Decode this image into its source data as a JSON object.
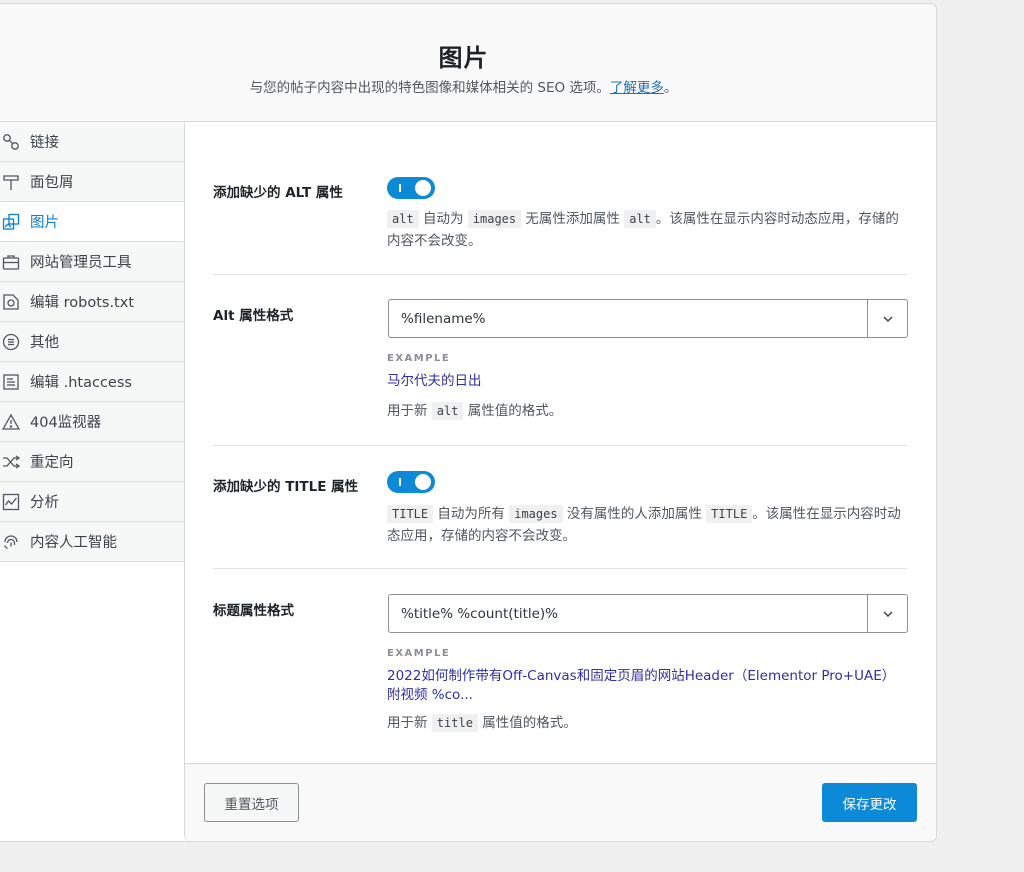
{
  "header": {
    "title": "图片",
    "description": "与您的帖子内容中出现的特色图像和媒体相关的 SEO 选项。",
    "learn_more": "了解更多",
    "description_end": "。"
  },
  "sidebar": {
    "items": [
      {
        "label": "链接",
        "icon": "link-icon"
      },
      {
        "label": "面包屑",
        "icon": "signpost-icon"
      },
      {
        "label": "图片",
        "icon": "images-icon",
        "active": true
      },
      {
        "label": "网站管理员工具",
        "icon": "briefcase-icon"
      },
      {
        "label": "编辑 robots.txt",
        "icon": "robot-file-icon"
      },
      {
        "label": "其他",
        "icon": "list-circle-icon"
      },
      {
        "label": "编辑 .htaccess",
        "icon": "document-icon"
      },
      {
        "label": "404监视器",
        "icon": "warning-icon"
      },
      {
        "label": "重定向",
        "icon": "shuffle-icon"
      },
      {
        "label": "分析",
        "icon": "chart-icon"
      },
      {
        "label": "内容人工智能",
        "icon": "fingerprint-icon"
      }
    ]
  },
  "settings": {
    "alt_toggle": {
      "label": "添加缺少的 ALT 属性",
      "enabled": true,
      "code1": "alt",
      "text1": " 自动为 ",
      "code2": "images",
      "text2": " 无属性添加属性 ",
      "code3": "alt",
      "text3": "。该属性在显示内容时动态应用，存储的内容不会改变。"
    },
    "alt_format": {
      "label": "Alt 属性格式",
      "value": "%filename%",
      "example_tag": "EXAMPLE",
      "example_value": "马尔代夫的日出",
      "help_pre": "用于新 ",
      "help_code": "alt",
      "help_post": " 属性值的格式。"
    },
    "title_toggle": {
      "label": "添加缺少的 TITLE 属性",
      "enabled": true,
      "code1": "TITLE",
      "text1": " 自动为所有 ",
      "code2": "images",
      "text2": " 没有属性的人添加属性 ",
      "code3": "TITLE",
      "text3": "。该属性在显示内容时动态应用，存储的内容不会改变。"
    },
    "title_format": {
      "label": "标题属性格式",
      "value": "%title% %count(title)%",
      "example_tag": "EXAMPLE",
      "example_value": "2022如何制作带有Off-Canvas和固定页眉的网站Header（Elementor Pro+UAE）附视频 %co...",
      "help_pre": "用于新 ",
      "help_code": "title",
      "help_post": " 属性值的格式。"
    }
  },
  "footer": {
    "reset_label": "重置选项",
    "save_label": "保存更改"
  },
  "colors": {
    "accent": "#0c8ad8",
    "active_nav": "#0b7fd1",
    "link": "#2271b1",
    "example": "#2f2fa0"
  }
}
